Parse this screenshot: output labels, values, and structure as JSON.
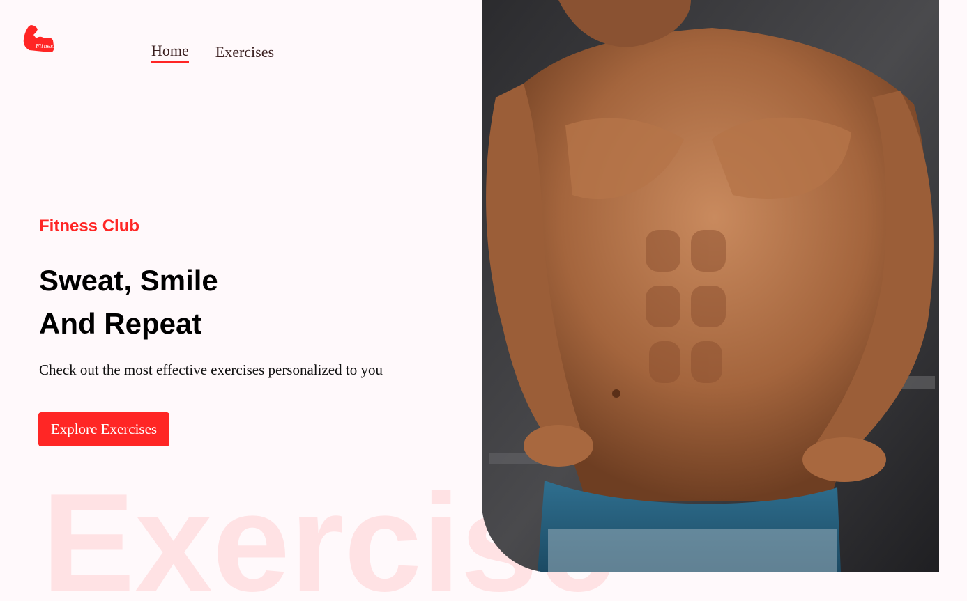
{
  "logo": {
    "icon": "flexed-bicep-icon",
    "text": "Fitness",
    "color": "#ff2625"
  },
  "nav": {
    "items": [
      {
        "label": "Home",
        "active": true
      },
      {
        "label": "Exercises",
        "active": false
      }
    ]
  },
  "hero": {
    "tagline": "Fitness Club",
    "headline_line1": "Sweat, Smile",
    "headline_line2": "And Repeat",
    "subtitle": "Check out the most effective exercises personalized to you",
    "cta_label": "Explore Exercises",
    "background_word": "Exercise",
    "image": "muscular-man-torso-photo"
  },
  "colors": {
    "accent": "#ff2625",
    "background": "#fff9fb"
  }
}
